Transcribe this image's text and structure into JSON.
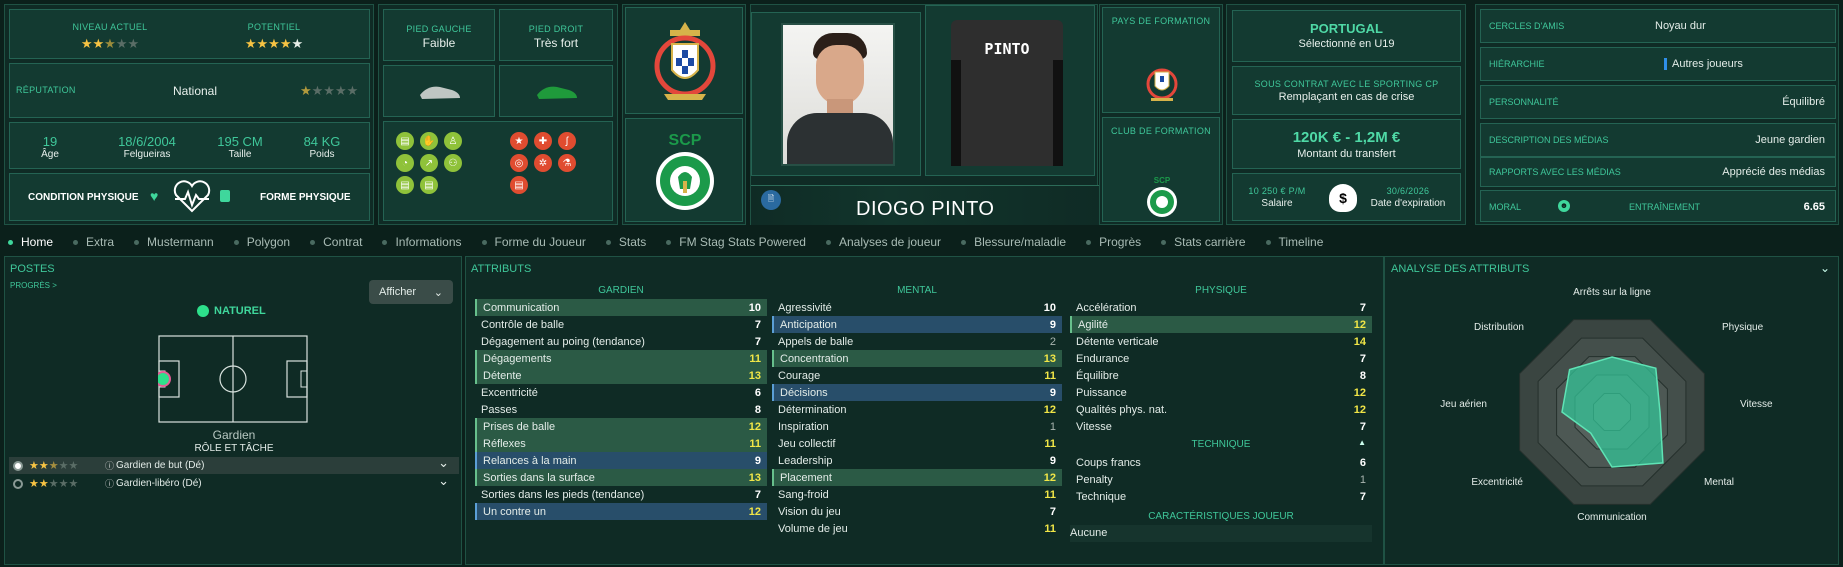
{
  "header": {
    "current_level": {
      "label": "NIVEAU ACTUEL",
      "stars": 2.5
    },
    "potential": {
      "label": "POTENTIEL",
      "stars": 4.5
    },
    "reputation": {
      "label": "RÉPUTATION",
      "value": "National",
      "stars": 0.5
    },
    "age": {
      "value": "19",
      "label": "Âge"
    },
    "birth": {
      "value": "18/6/2004",
      "label": "Felgueiras"
    },
    "height": {
      "value": "195 CM",
      "label": "Taille"
    },
    "weight": {
      "value": "84 KG",
      "label": "Poids"
    },
    "condition_label": "CONDITION PHYSIQUE",
    "form_label": "FORME PHYSIQUE",
    "left_foot": {
      "label": "PIED GAUCHE",
      "value": "Faible"
    },
    "right_foot": {
      "label": "PIED DROIT",
      "value": "Très fort"
    },
    "player_name": "DIOGO PINTO",
    "shirt_name": "PINTO",
    "formation_country_label": "PAYS DE FORMATION",
    "formation_club_label": "CLUB DE FORMATION",
    "nation": {
      "title": "PORTUGAL",
      "sub": "Sélectionné en U19"
    },
    "contract": {
      "title": "SOUS CONTRAT AVEC LE SPORTING CP",
      "sub": "Remplaçant en cas de crise"
    },
    "transfer": {
      "value": "120K € - 1,2M €",
      "label": "Montant du transfert"
    },
    "salary": {
      "value": "10 250 € P/M",
      "label": "Salaire"
    },
    "expiry": {
      "value": "30/6/2026",
      "label": "Date d'expiration"
    },
    "info_rows": [
      {
        "label": "CERCLES D'AMIS",
        "value": "Noyau dur"
      },
      {
        "label": "HIÉRARCHIE",
        "value": "Autres joueurs"
      },
      {
        "label": "PERSONNALITÉ",
        "value": "Équilibré"
      },
      {
        "label": "DESCRIPTION DES MÉDIAS",
        "value": "Jeune gardien"
      },
      {
        "label": "RAPPORTS AVEC LES MÉDIAS",
        "value": "Apprécié des médias"
      }
    ],
    "morale_label": "MORAL",
    "training_label": "ENTRAÎNEMENT",
    "training_value": "6.65"
  },
  "tabs": [
    "Home",
    "Extra",
    "Mustermann",
    "Polygon",
    "Contrat",
    "Informations",
    "Forme du Joueur",
    "Stats",
    "FM Stag Stats Powered",
    "Analyses de joueur",
    "Blessure/maladie",
    "Progrès",
    "Stats carrière",
    "Timeline"
  ],
  "positions": {
    "title": "POSTES",
    "progress": "PROGRÈS >",
    "show_button": "Afficher",
    "natural": "NATUREL",
    "position_name": "Gardien",
    "role_title": "RÔLE ET TÂCHE",
    "roles": [
      {
        "name": "Gardien de but (Dé)",
        "stars": 2.5
      },
      {
        "name": "Gardien-libéro (Dé)",
        "stars": 2
      }
    ]
  },
  "attributes": {
    "title": "ATTRIBUTS",
    "goalkeeper_head": "GARDIEN",
    "mental_head": "MENTAL",
    "physical_head": "PHYSIQUE",
    "technical_head": "TECHNIQUE",
    "traits_head": "CARACTÉRISTIQUES JOUEUR",
    "traits_value": "Aucune",
    "goalkeeper": [
      {
        "name": "Communication",
        "value": "10",
        "hl": "green"
      },
      {
        "name": "Contrôle de balle",
        "value": "7",
        "hl": ""
      },
      {
        "name": "Dégagement au poing (tendance)",
        "value": "7",
        "hl": ""
      },
      {
        "name": "Dégagements",
        "value": "11",
        "hl": "green"
      },
      {
        "name": "Détente",
        "value": "13",
        "hl": "green"
      },
      {
        "name": "Excentricité",
        "value": "6",
        "hl": ""
      },
      {
        "name": "Passes",
        "value": "8",
        "hl": ""
      },
      {
        "name": "Prises de balle",
        "value": "12",
        "hl": "green"
      },
      {
        "name": "Réflexes",
        "value": "11",
        "hl": "green"
      },
      {
        "name": "Relances à la main",
        "value": "9",
        "hl": "blue"
      },
      {
        "name": "Sorties dans la surface",
        "value": "13",
        "hl": "green"
      },
      {
        "name": "Sorties dans les pieds (tendance)",
        "value": "7",
        "hl": ""
      },
      {
        "name": "Un contre un",
        "value": "12",
        "hl": "blue"
      }
    ],
    "mental": [
      {
        "name": "Agressivité",
        "value": "10",
        "hl": ""
      },
      {
        "name": "Anticipation",
        "value": "9",
        "hl": "blue"
      },
      {
        "name": "Appels de balle",
        "value": "2",
        "hl": ""
      },
      {
        "name": "Concentration",
        "value": "13",
        "hl": "green"
      },
      {
        "name": "Courage",
        "value": "11",
        "hl": ""
      },
      {
        "name": "Décisions",
        "value": "9",
        "hl": "blue"
      },
      {
        "name": "Détermination",
        "value": "12",
        "hl": ""
      },
      {
        "name": "Inspiration",
        "value": "1",
        "hl": ""
      },
      {
        "name": "Jeu collectif",
        "value": "11",
        "hl": ""
      },
      {
        "name": "Leadership",
        "value": "9",
        "hl": ""
      },
      {
        "name": "Placement",
        "value": "12",
        "hl": "green"
      },
      {
        "name": "Sang-froid",
        "value": "11",
        "hl": ""
      },
      {
        "name": "Vision du jeu",
        "value": "7",
        "hl": ""
      },
      {
        "name": "Volume de jeu",
        "value": "11",
        "hl": ""
      }
    ],
    "physical": [
      {
        "name": "Accélération",
        "value": "7",
        "hl": ""
      },
      {
        "name": "Agilité",
        "value": "12",
        "hl": "green"
      },
      {
        "name": "Détente verticale",
        "value": "14",
        "hl": ""
      },
      {
        "name": "Endurance",
        "value": "7",
        "hl": ""
      },
      {
        "name": "Équilibre",
        "value": "8",
        "hl": ""
      },
      {
        "name": "Puissance",
        "value": "12",
        "hl": ""
      },
      {
        "name": "Qualités phys. nat.",
        "value": "12",
        "hl": ""
      },
      {
        "name": "Vitesse",
        "value": "7",
        "hl": ""
      }
    ],
    "technical": [
      {
        "name": "Coups francs",
        "value": "6",
        "hl": ""
      },
      {
        "name": "Penalty",
        "value": "1",
        "hl": ""
      },
      {
        "name": "Technique",
        "value": "7",
        "hl": ""
      }
    ]
  },
  "analysis": {
    "title": "ANALYSE DES ATTRIBUTS",
    "axes": [
      "Arrêts sur la ligne",
      "Physique",
      "Vitesse",
      "Mental",
      "Communication",
      "Excentricité",
      "Jeu aérien",
      "Distribution"
    ],
    "values": [
      0.55,
      0.62,
      0.48,
      0.72,
      0.55,
      0.3,
      0.5,
      0.6
    ]
  },
  "colors": {
    "accent": "#3fc79a",
    "bg": "#0b201b",
    "panel": "#12322b",
    "yellow": "#f1e647"
  }
}
